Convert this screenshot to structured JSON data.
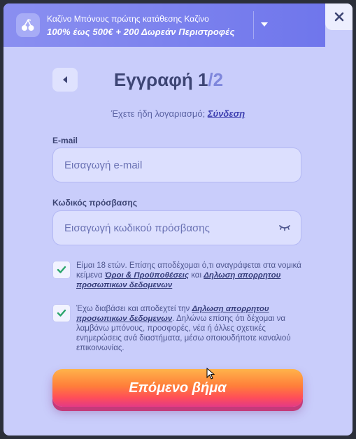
{
  "banner": {
    "line1": "Καζίνο Μπόνους πρώτης κατάθεσης Καζίνο",
    "line2": "100% έως 500€ + 200 Δωρεάν Περιστροφές",
    "icon": "cherries-icon"
  },
  "close": {
    "label": "✕"
  },
  "header": {
    "title": "Εγγραφή ",
    "step_current": "1",
    "step_total": "/2"
  },
  "login": {
    "prompt": "Έχετε ήδη λογαριασμό; ",
    "link": "Σύνδεση"
  },
  "email": {
    "label": "E-mail",
    "placeholder": "Εισαγωγή e-mail",
    "value": ""
  },
  "password": {
    "label": "Κωδικός πρόσβασης",
    "placeholder": "Εισαγωγή κωδικού πρόσβασης",
    "value": ""
  },
  "consent1": {
    "checked": true,
    "text_a": "Είμαι 18 ετών. Επίσης αποδέχομαι ό,τι αναγράφεται στα νομικά κείμενα ",
    "link_terms": "Όροι & Προϋποθέσεις",
    "text_b": " και ",
    "link_privacy": "Δηλωση απορρητου προσωπικων δεδομενων"
  },
  "consent2": {
    "checked": true,
    "text_a": "Έχω διαβάσει και αποδεχτεί την ",
    "link_privacy": "Δηλωση απορρητου προσωπικων δεδομενων",
    "text_b": ". Δηλώνω επίσης ότι δέχομαι να λαμβάνω μπόνους, προσφορές, νέα ή άλλες σχετικές ενημερώσεις ανά διαστήματα, μέσω οποιουδήποτε καναλιού επικοινωνίας."
  },
  "cta": {
    "label": "Επόμενο βήμα"
  },
  "colors": {
    "panel": "#c9cdfb",
    "banner": "#7b81ee",
    "title": "#3d4574",
    "accent": "#7f87dc",
    "check": "#2aa56b",
    "cta_top": "#ffb34a",
    "cta_bottom": "#e33a86"
  }
}
